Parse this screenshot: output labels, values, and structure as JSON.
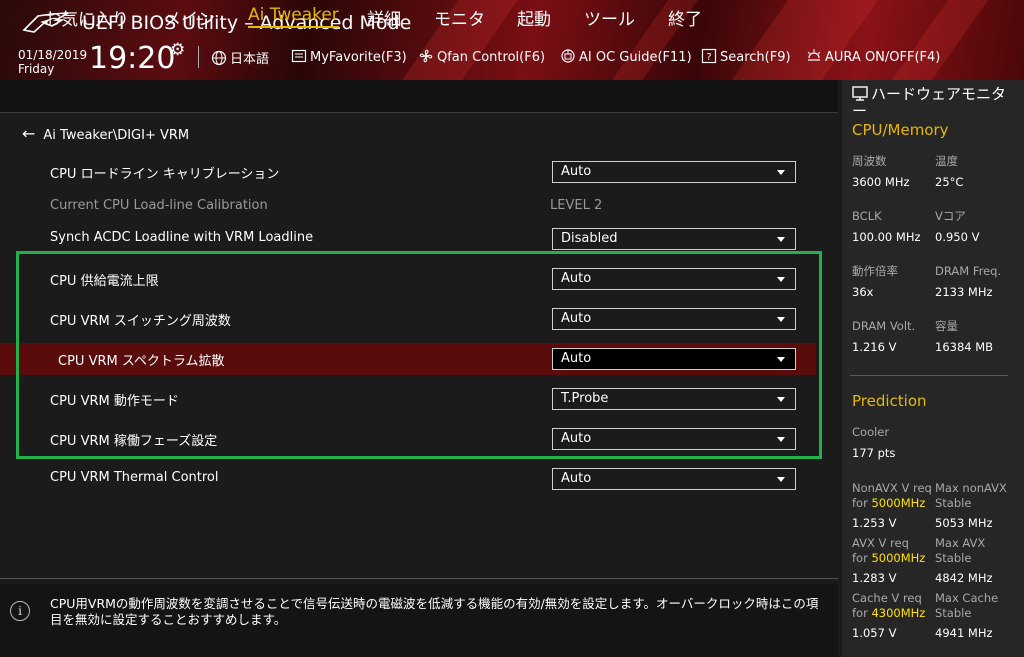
{
  "header": {
    "title": "UEFI BIOS Utility – Advanced Mode",
    "date": "01/18/2019",
    "day": "Friday",
    "time": "19:20",
    "tools": [
      {
        "label": "日本語",
        "icon": "globe-icon"
      },
      {
        "label": "MyFavorite(F3)",
        "icon": "favorite-icon"
      },
      {
        "label": "Qfan Control(F6)",
        "icon": "fan-icon"
      },
      {
        "label": "AI OC Guide(F11)",
        "icon": "ai-oc-guide-icon"
      },
      {
        "label": "Search(F9)",
        "icon": "search-icon"
      },
      {
        "label": "AURA ON/OFF(F4)",
        "icon": "aura-icon"
      }
    ]
  },
  "menu": {
    "items": [
      "お気に入り",
      "メイン",
      "Ai Tweaker",
      "詳細",
      "モニタ",
      "起動",
      "ツール",
      "終了"
    ],
    "active": "Ai Tweaker"
  },
  "breadcrumb": "Ai Tweaker\\DIGI+ VRM",
  "settings": [
    {
      "label": "CPU ロードライン キャリブレーション",
      "value": "Auto",
      "type": "select"
    },
    {
      "label": "Current CPU Load-line Calibration",
      "value": "LEVEL 2",
      "type": "text"
    },
    {
      "label": "Synch ACDC Loadline with VRM Loadline",
      "value": "Disabled",
      "type": "select"
    },
    {
      "label": "CPU 供給電流上限",
      "value": "Auto",
      "type": "select"
    },
    {
      "label": "CPU VRM スイッチング周波数",
      "value": "Auto",
      "type": "select"
    },
    {
      "label": "CPU VRM スペクトラム拡散",
      "value": "Auto",
      "type": "select",
      "selected": true
    },
    {
      "label": "CPU VRM 動作モード",
      "value": "T.Probe",
      "type": "select"
    },
    {
      "label": "CPU VRM 稼働フェーズ設定",
      "value": "Auto",
      "type": "select"
    },
    {
      "label": "CPU VRM Thermal Control",
      "value": "Auto",
      "type": "select"
    }
  ],
  "help": {
    "text": "CPU用VRMの動作周波数を変調させることで信号伝送時の電磁波を低減する機能の有効/無効を設定します。オーバークロック時はこの項目を無効に設定することおすすめします。"
  },
  "monitor": {
    "title": "ハードウェアモニター",
    "cpu_memory": {
      "heading": "CPU/Memory",
      "items": [
        {
          "label": "周波数",
          "value": "3600 MHz"
        },
        {
          "label": "温度",
          "value": "25°C"
        },
        {
          "label": "BCLK",
          "value": "100.00 MHz"
        },
        {
          "label": "Vコア",
          "value": "0.950 V"
        },
        {
          "label": "動作倍率",
          "value": "36x"
        },
        {
          "label": "DRAM Freq.",
          "value": "2133 MHz"
        },
        {
          "label": "DRAM Volt.",
          "value": "1.216 V"
        },
        {
          "label": "容量",
          "value": "16384 MB"
        }
      ]
    },
    "prediction": {
      "heading": "Prediction",
      "cooler_label": "Cooler",
      "cooler_value": "177 pts",
      "nonavx_label": "NonAVX V req",
      "nonavx_for": "for",
      "nonavx_freq": "5000MHz",
      "nonavx_value": "1.253 V",
      "max_nonavx_label": "Max nonAVX",
      "max_nonavx_sub": "Stable",
      "max_nonavx_value": "5053 MHz",
      "avx_label": "AVX V req",
      "avx_for": "for",
      "avx_freq": "5000MHz",
      "avx_value": "1.283 V",
      "max_avx_label": "Max AVX",
      "max_avx_sub": "Stable",
      "max_avx_value": "4842 MHz",
      "cache_label": "Cache V req",
      "cache_for": "for",
      "cache_freq": "4300MHz",
      "cache_value": "1.057 V",
      "max_cache_label": "Max Cache",
      "max_cache_sub": "Stable",
      "max_cache_value": "4941 MHz"
    }
  }
}
